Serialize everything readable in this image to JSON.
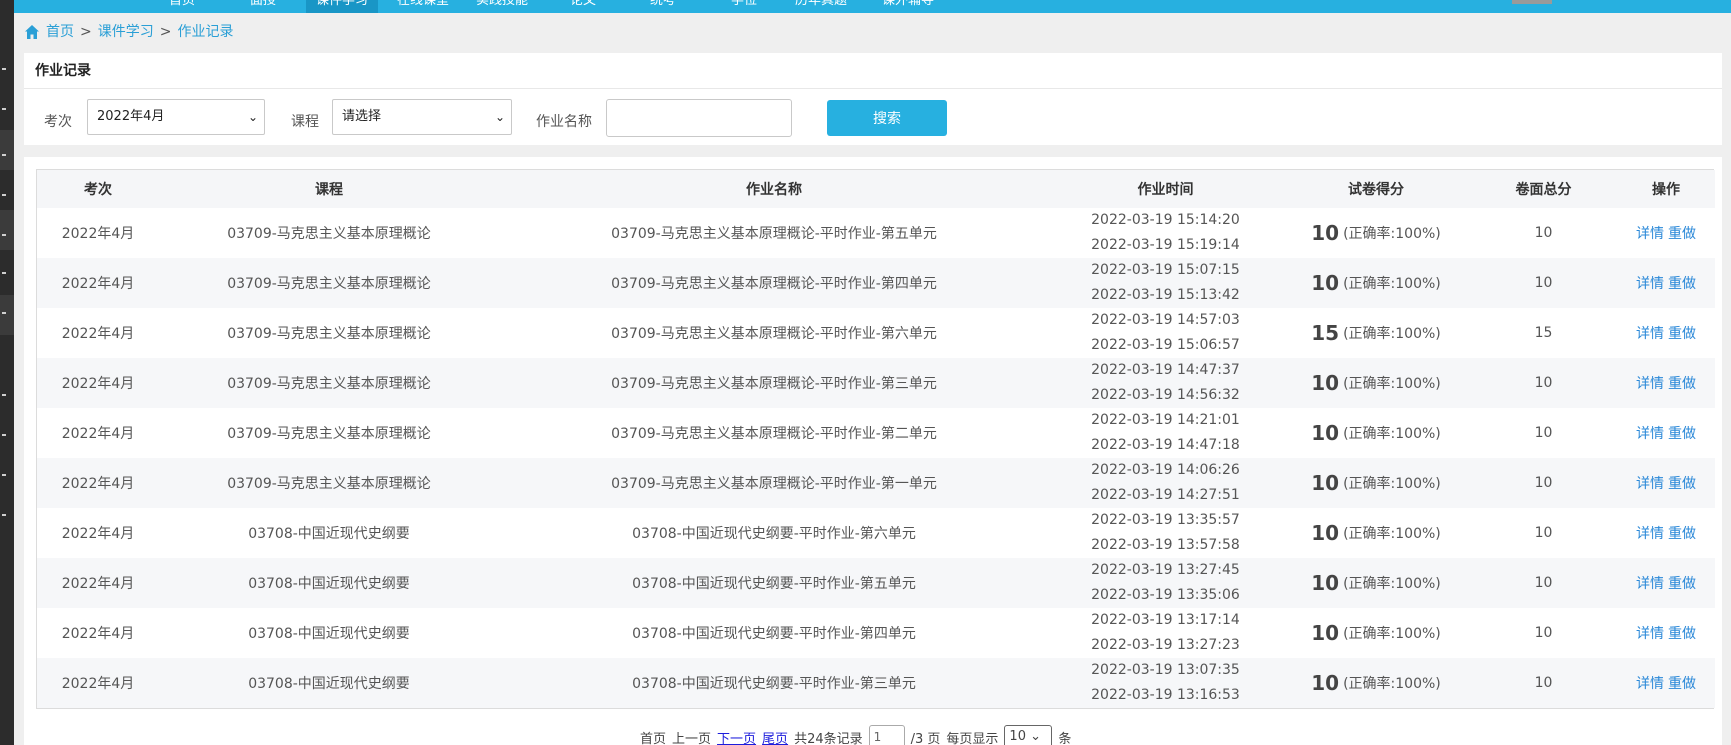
{
  "topnav": {
    "items": [
      "首页",
      "面授",
      "课件学习",
      "在线课堂",
      "实践技能",
      "论文",
      "统考",
      "学位",
      "历年真题",
      "课外辅导"
    ],
    "active_index": 2
  },
  "breadcrumb": {
    "home": "首页",
    "sep1": ">",
    "level2": "课件学习",
    "sep2": ">",
    "current": "作业记录"
  },
  "panel": {
    "title": "作业记录",
    "filters": {
      "exam_label": "考次",
      "exam_value": "2022年4月",
      "course_label": "课程",
      "course_value": "请选择",
      "name_label": "作业名称",
      "name_value": ""
    },
    "search_button": "搜索"
  },
  "table": {
    "headers": [
      "考次",
      "课程",
      "作业名称",
      "作业时间",
      "试卷得分",
      "卷面总分",
      "操作"
    ],
    "rows": [
      {
        "exam": "2022年4月",
        "course": "03709-马克思主义基本原理概论",
        "name": "03709-马克思主义基本原理概论-平时作业-第五单元",
        "start": "2022-03-19 15:14:20",
        "end": "2022-03-19 15:19:14",
        "score": "10",
        "rate": "(正确率:100%)",
        "total": "10",
        "detail": "详情",
        "redo": "重做"
      },
      {
        "exam": "2022年4月",
        "course": "03709-马克思主义基本原理概论",
        "name": "03709-马克思主义基本原理概论-平时作业-第四单元",
        "start": "2022-03-19 15:07:15",
        "end": "2022-03-19 15:13:42",
        "score": "10",
        "rate": "(正确率:100%)",
        "total": "10",
        "detail": "详情",
        "redo": "重做"
      },
      {
        "exam": "2022年4月",
        "course": "03709-马克思主义基本原理概论",
        "name": "03709-马克思主义基本原理概论-平时作业-第六单元",
        "start": "2022-03-19 14:57:03",
        "end": "2022-03-19 15:06:57",
        "score": "15",
        "rate": "(正确率:100%)",
        "total": "15",
        "detail": "详情",
        "redo": "重做"
      },
      {
        "exam": "2022年4月",
        "course": "03709-马克思主义基本原理概论",
        "name": "03709-马克思主义基本原理概论-平时作业-第三单元",
        "start": "2022-03-19 14:47:37",
        "end": "2022-03-19 14:56:32",
        "score": "10",
        "rate": "(正确率:100%)",
        "total": "10",
        "detail": "详情",
        "redo": "重做"
      },
      {
        "exam": "2022年4月",
        "course": "03709-马克思主义基本原理概论",
        "name": "03709-马克思主义基本原理概论-平时作业-第二单元",
        "start": "2022-03-19 14:21:01",
        "end": "2022-03-19 14:47:18",
        "score": "10",
        "rate": "(正确率:100%)",
        "total": "10",
        "detail": "详情",
        "redo": "重做"
      },
      {
        "exam": "2022年4月",
        "course": "03709-马克思主义基本原理概论",
        "name": "03709-马克思主义基本原理概论-平时作业-第一单元",
        "start": "2022-03-19 14:06:26",
        "end": "2022-03-19 14:27:51",
        "score": "10",
        "rate": "(正确率:100%)",
        "total": "10",
        "detail": "详情",
        "redo": "重做"
      },
      {
        "exam": "2022年4月",
        "course": "03708-中国近现代史纲要",
        "name": "03708-中国近现代史纲要-平时作业-第六单元",
        "start": "2022-03-19 13:35:57",
        "end": "2022-03-19 13:57:58",
        "score": "10",
        "rate": "(正确率:100%)",
        "total": "10",
        "detail": "详情",
        "redo": "重做"
      },
      {
        "exam": "2022年4月",
        "course": "03708-中国近现代史纲要",
        "name": "03708-中国近现代史纲要-平时作业-第五单元",
        "start": "2022-03-19 13:27:45",
        "end": "2022-03-19 13:35:06",
        "score": "10",
        "rate": "(正确率:100%)",
        "total": "10",
        "detail": "详情",
        "redo": "重做"
      },
      {
        "exam": "2022年4月",
        "course": "03708-中国近现代史纲要",
        "name": "03708-中国近现代史纲要-平时作业-第四单元",
        "start": "2022-03-19 13:17:14",
        "end": "2022-03-19 13:27:23",
        "score": "10",
        "rate": "(正确率:100%)",
        "total": "10",
        "detail": "详情",
        "redo": "重做"
      },
      {
        "exam": "2022年4月",
        "course": "03708-中国近现代史纲要",
        "name": "03708-中国近现代史纲要-平时作业-第三单元",
        "start": "2022-03-19 13:07:35",
        "end": "2022-03-19 13:16:53",
        "score": "10",
        "rate": "(正确率:100%)",
        "total": "10",
        "detail": "详情",
        "redo": "重做"
      }
    ]
  },
  "pagination": {
    "first": "首页",
    "prev": "上一页",
    "next": "下一页",
    "last": "尾页",
    "total_records": "共24条记录",
    "page_input": "1",
    "page_total": "/3 页",
    "per_page_label": "每页显示",
    "per_page_value": "10",
    "unit": "条"
  },
  "colors": {
    "nav_bg": "#27b0e0",
    "nav_active": "#1996c6",
    "link": "#2a88d8",
    "search_button": "#27b0e0"
  }
}
